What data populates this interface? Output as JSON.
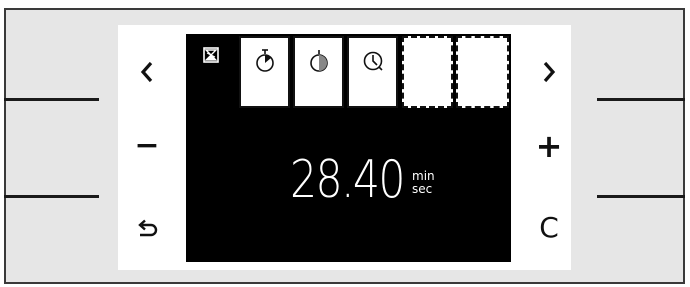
{
  "controls": {
    "prev_icon": "chevron-left-icon",
    "next_icon": "chevron-right-icon",
    "minus_label": "−",
    "plus_label": "+",
    "back_icon": "back-arrow-icon",
    "clear_label": "C"
  },
  "tabs": [
    {
      "icon": "hourglass-icon",
      "state": "active"
    },
    {
      "icon": "stopwatch-icon",
      "state": "normal"
    },
    {
      "icon": "half-timer-icon",
      "state": "normal"
    },
    {
      "icon": "clock-icon",
      "state": "normal"
    },
    {
      "icon": "empty-slot",
      "state": "empty"
    },
    {
      "icon": "empty-slot",
      "state": "empty"
    }
  ],
  "display": {
    "value": "28.40",
    "unit_top": "min",
    "unit_bottom": "sec"
  },
  "colors": {
    "screen": "#000000",
    "frame": "#e6e6e6",
    "text": "#ffffff"
  }
}
